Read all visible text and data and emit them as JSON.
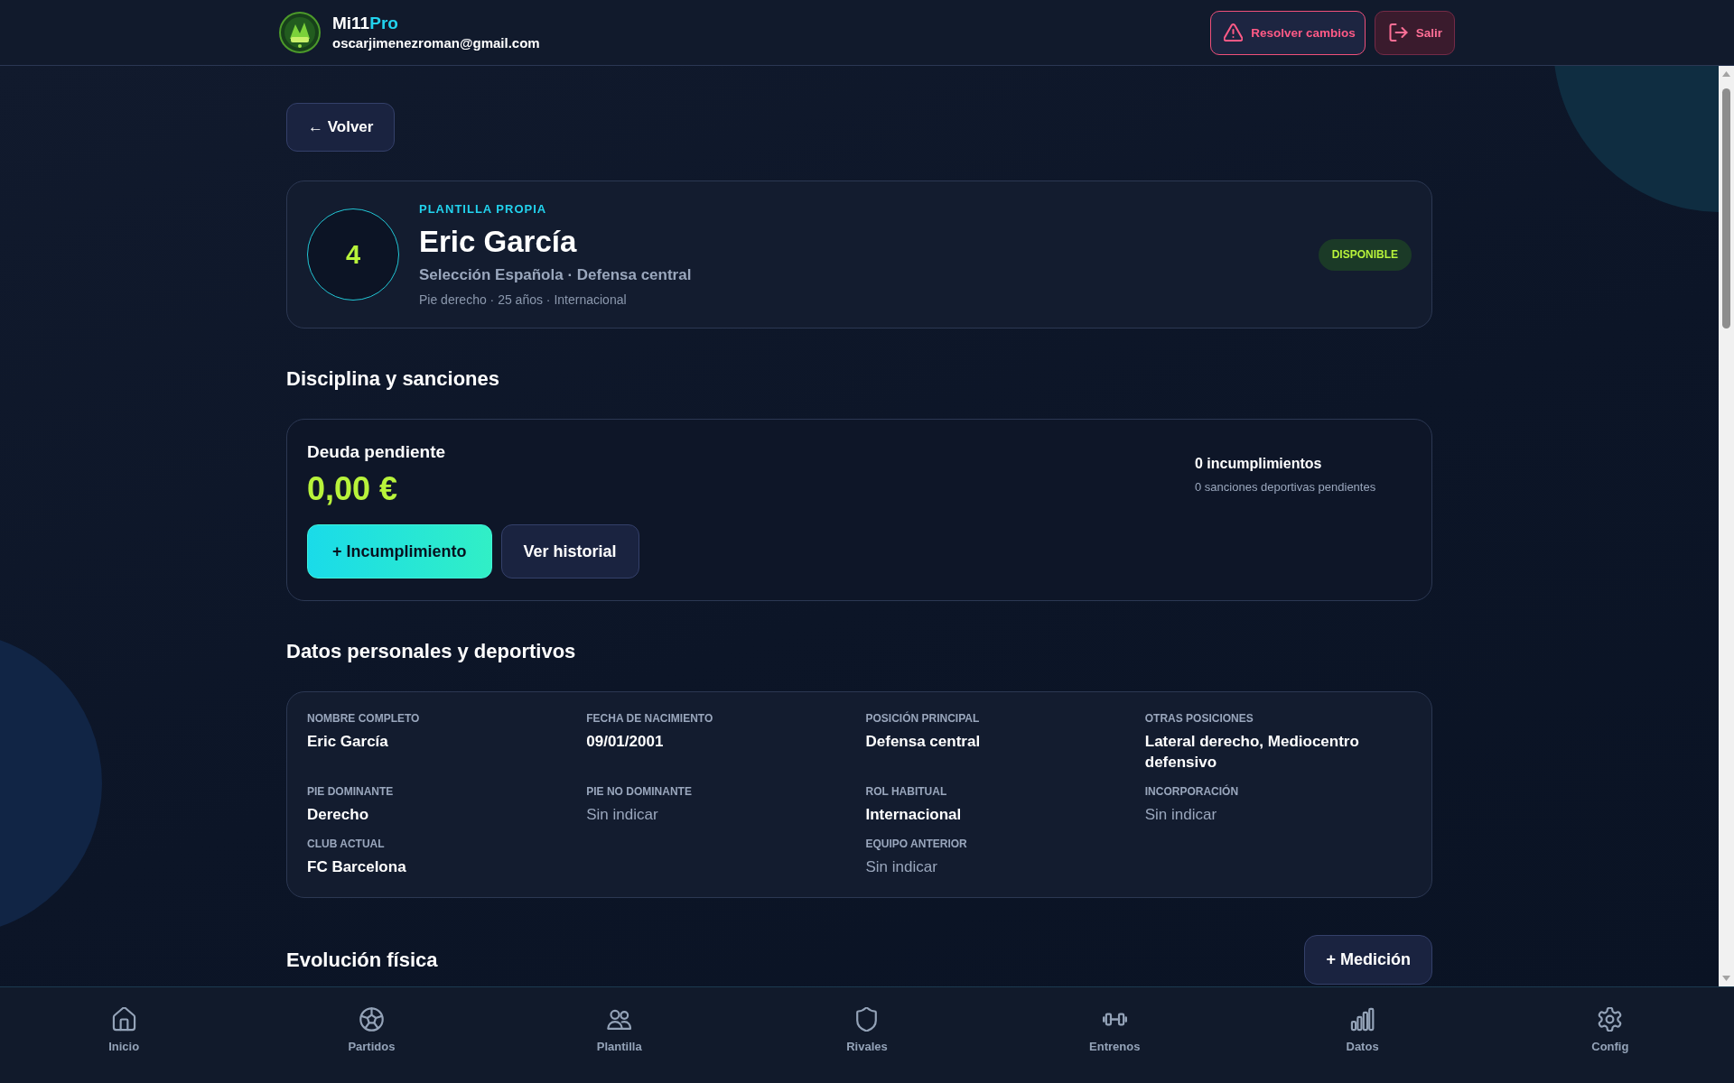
{
  "header": {
    "brand": {
      "name": "Mi11",
      "accent": "Pro"
    },
    "email": "oscarjimenezroman@gmail.com",
    "actions": [
      {
        "label": "Resolver cambios",
        "kind": "warning"
      },
      {
        "label": "Salir",
        "kind": "logout"
      }
    ]
  },
  "back_button": "← Volver",
  "player": {
    "number": "4",
    "group": "PLANTILLA PROPIA",
    "name": "Eric García",
    "subtitle": "Selección Española · Defensa central",
    "details": "Pie derecho · 25 años · Internacional",
    "status": "DISPONIBLE"
  },
  "discipline": {
    "title": "Disciplina y sanciones",
    "debt_label": "Deuda pendiente",
    "debt_amount": "0,00 €",
    "buttons": [
      {
        "label": "+ Incumplimiento",
        "kind": "primary"
      },
      {
        "label": "Ver historial",
        "kind": "secondary"
      }
    ],
    "breaches": "0 incumplimientos",
    "sanctions": "0 sanciones deportivas pendientes"
  },
  "personal_data": {
    "title": "Datos personales y deportivos",
    "rows": [
      [
        {
          "label": "NOMBRE COMPLETO",
          "value": "Eric García",
          "missing": false
        },
        {
          "label": "FECHA DE NACIMIENTO",
          "value": "09/01/2001",
          "missing": false
        },
        {
          "label": "POSICIÓN PRINCIPAL",
          "value": "Defensa central",
          "missing": false
        },
        {
          "label": "OTRAS POSICIONES",
          "value": "Lateral derecho, Mediocentro defensivo",
          "missing": false
        }
      ],
      [
        {
          "label": "PIE DOMINANTE",
          "value": "Derecho",
          "missing": false
        },
        {
          "label": "PIE NO DOMINANTE",
          "value": "Sin indicar",
          "missing": true
        },
        {
          "label": "ROL HABITUAL",
          "value": "Internacional",
          "missing": false
        },
        {
          "label": "INCORPORACIÓN",
          "value": "Sin indicar",
          "missing": true
        }
      ],
      [
        {
          "label": "CLUB ACTUAL",
          "value": "FC Barcelona",
          "missing": false
        },
        null,
        {
          "label": "EQUIPO ANTERIOR",
          "value": "Sin indicar",
          "missing": true
        }
      ]
    ]
  },
  "physical_evolution": {
    "title": "Evolución física",
    "button": "+ Medición"
  },
  "bottom_nav": [
    {
      "label": "Inicio",
      "selected": false
    },
    {
      "label": "Partidos",
      "selected": false
    },
    {
      "label": "Plantilla",
      "selected": false
    },
    {
      "label": "Rivales",
      "selected": false
    },
    {
      "label": "Entrenos",
      "selected": false
    },
    {
      "label": "Datos",
      "selected": false
    },
    {
      "label": "Config",
      "selected": false
    }
  ]
}
